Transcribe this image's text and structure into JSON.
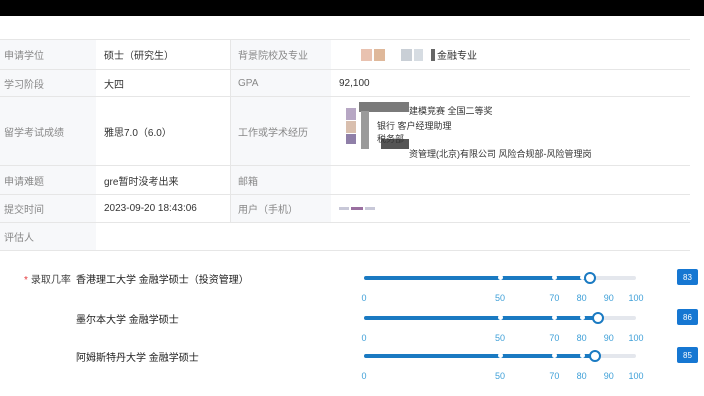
{
  "info": {
    "row1": {
      "label_a": "申请学位",
      "value_a": "硕士（研究生）",
      "label_b": "背景院校及专业",
      "value_b": "金融专业"
    },
    "row2": {
      "label_a": "学习阶段",
      "value_a": "大四",
      "label_b": "GPA",
      "value_b": "92,100"
    },
    "row3": {
      "label_a": "留学考试成绩",
      "value_a": "雅思7.0（6.0）",
      "label_b": "工作或学术经历",
      "exp_line1": "建模竞赛 全国二等奖",
      "exp_line2": "银行 客户经理助理",
      "exp_line3": "税务部",
      "exp_line4": "资管理(北京)有限公司 风险合规部-风险管理岗"
    },
    "row4": {
      "label_a": "申请难题",
      "value_a": "gre暂时没考出来",
      "label_b": "邮箱",
      "value_b": ""
    },
    "row5": {
      "label_a": "提交时间",
      "value_a": "2023-09-20 18:43:06",
      "label_b": "用户（手机）",
      "value_b": ""
    },
    "row6": {
      "label_a": "评估人",
      "value_a": ""
    }
  },
  "admission": {
    "label": "录取几率",
    "ticks": [
      "0",
      "50",
      "70",
      "80",
      "90",
      "100"
    ],
    "items": [
      {
        "school": "香港理工大学 金融学硕士（投资管理）",
        "value": 83,
        "score": "83"
      },
      {
        "school": "墨尔本大学 金融学硕士",
        "value": 86,
        "score": "86"
      },
      {
        "school": "阿姆斯特丹大学 金融学硕士",
        "value": 85,
        "score": "85"
      }
    ]
  },
  "colors": {
    "accent": "#1677d2",
    "track": "#e4e7ed",
    "label_bg": "#f7f8fa",
    "tick_text": "#3fa0d8"
  }
}
